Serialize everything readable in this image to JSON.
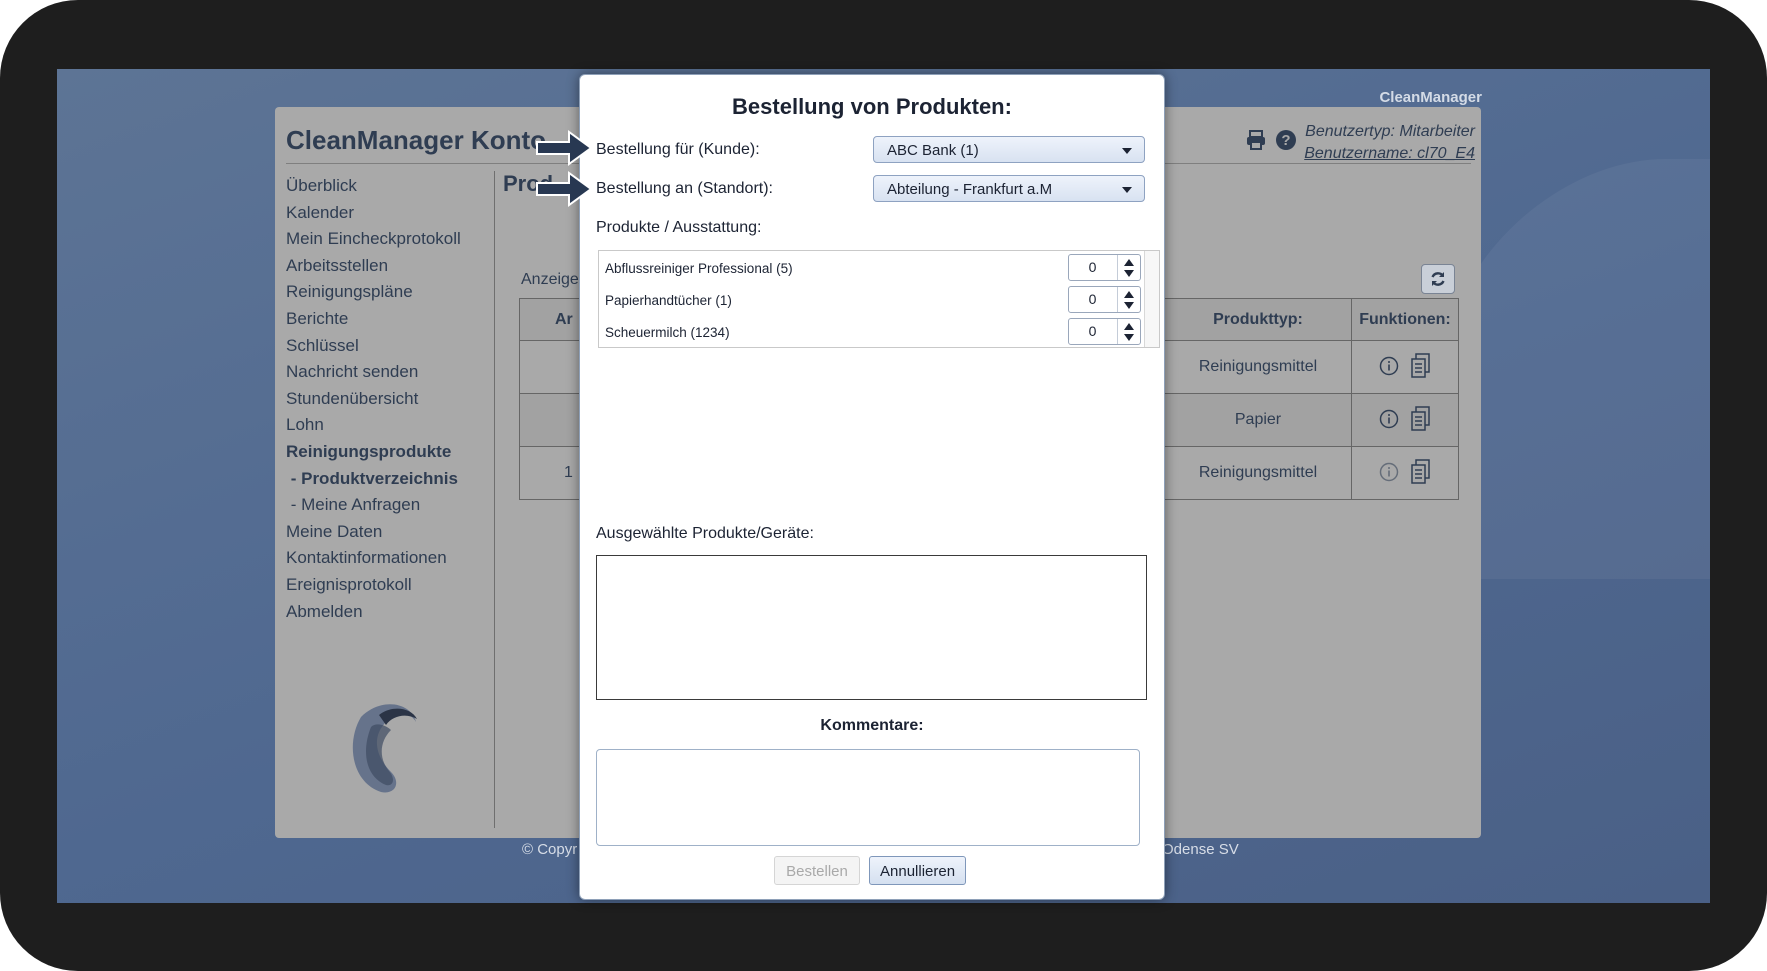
{
  "brand_top": "CleanManager",
  "app": {
    "title": "CleanManager Konto",
    "user_type": "Benutzertyp: Mitarbeiter",
    "user_name": "Benutzername: cl70_E4",
    "page_heading": "Prod",
    "anzeige_label": "Anzeige"
  },
  "nav": {
    "items": [
      {
        "label": "Überblick"
      },
      {
        "label": "Kalender"
      },
      {
        "label": "Mein Eincheckprotokoll"
      },
      {
        "label": "Arbeitsstellen"
      },
      {
        "label": "Reinigungspläne"
      },
      {
        "label": "Berichte"
      },
      {
        "label": "Schlüssel"
      },
      {
        "label": "Nachricht senden"
      },
      {
        "label": "Stundenübersicht"
      },
      {
        "label": "Lohn"
      },
      {
        "label": "Reinigungsprodukte"
      },
      {
        "label": " - Produktverzeichnis"
      },
      {
        "label": " - Meine Anfragen"
      },
      {
        "label": "Meine Daten"
      },
      {
        "label": "Kontaktinformationen"
      },
      {
        "label": "Ereignisprotokoll"
      },
      {
        "label": "Abmelden"
      }
    ]
  },
  "table": {
    "headers": [
      "Ar",
      "Produkttyp:",
      "Funktionen:"
    ],
    "rows": [
      {
        "first": "",
        "type": "Reinigungsmittel"
      },
      {
        "first": "",
        "type": "Papier"
      },
      {
        "first": "1",
        "type": "Reinigungsmittel"
      }
    ]
  },
  "footer": {
    "left": "© Copyr",
    "right": "Odense SV"
  },
  "dialog": {
    "title": "Bestellung von Produkten:",
    "customer_label": "Bestellung für (Kunde):",
    "customer_value": "ABC Bank (1)",
    "location_label": "Bestellung an (Standort):",
    "location_value": "Abteilung - Frankfurt a.M",
    "products_label": "Produkte / Ausstattung:",
    "products": [
      {
        "name": "Abflussreiniger Professional (5)",
        "qty": "0"
      },
      {
        "name": "Papierhandtücher (1)",
        "qty": "0"
      },
      {
        "name": "Scheuermilch (1234)",
        "qty": "0"
      }
    ],
    "selected_label": "Ausgewählte Produkte/Geräte:",
    "comments_label": "Kommentare:",
    "order_button": "Bestellen",
    "cancel_button": "Annullieren"
  }
}
